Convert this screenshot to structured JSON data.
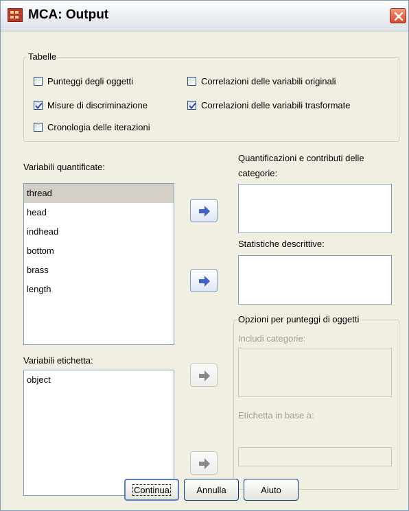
{
  "window": {
    "title": "MCA: Output"
  },
  "tables_group": {
    "legend": "Tabelle",
    "checkboxes": [
      {
        "label": "Punteggi degli oggetti",
        "checked": false
      },
      {
        "label": "Correlazioni delle variabili originali",
        "checked": false
      },
      {
        "label": "Misure di discriminazione",
        "checked": true
      },
      {
        "label": "Correlazioni delle variabili trasformate",
        "checked": true
      },
      {
        "label": "Cronologia delle iterazioni",
        "checked": false
      }
    ]
  },
  "quantified_vars": {
    "label": "Variabili quantificate:",
    "items": [
      "thread",
      "head",
      "indhead",
      "bottom",
      "brass",
      "length"
    ],
    "selected": "thread"
  },
  "label_vars": {
    "label": "Variabili etichetta:",
    "items": [
      "object"
    ]
  },
  "category_quantifications": {
    "label": "Quantificazioni e contributi delle categorie:"
  },
  "descriptive_stats": {
    "label": "Statistiche descrittive:"
  },
  "object_scores_options": {
    "legend": "Opzioni per punteggi di oggetti",
    "include_categories_label": "Includi categorie:",
    "label_by_label": "Etichetta in base a:"
  },
  "buttons": {
    "continue": "Continua",
    "cancel": "Annulla",
    "help": "Aiuto"
  },
  "colors": {
    "arrow_active": "#3f62c6",
    "arrow_disabled": "#8a8a8a",
    "checkmark": "#2a3fd1"
  }
}
